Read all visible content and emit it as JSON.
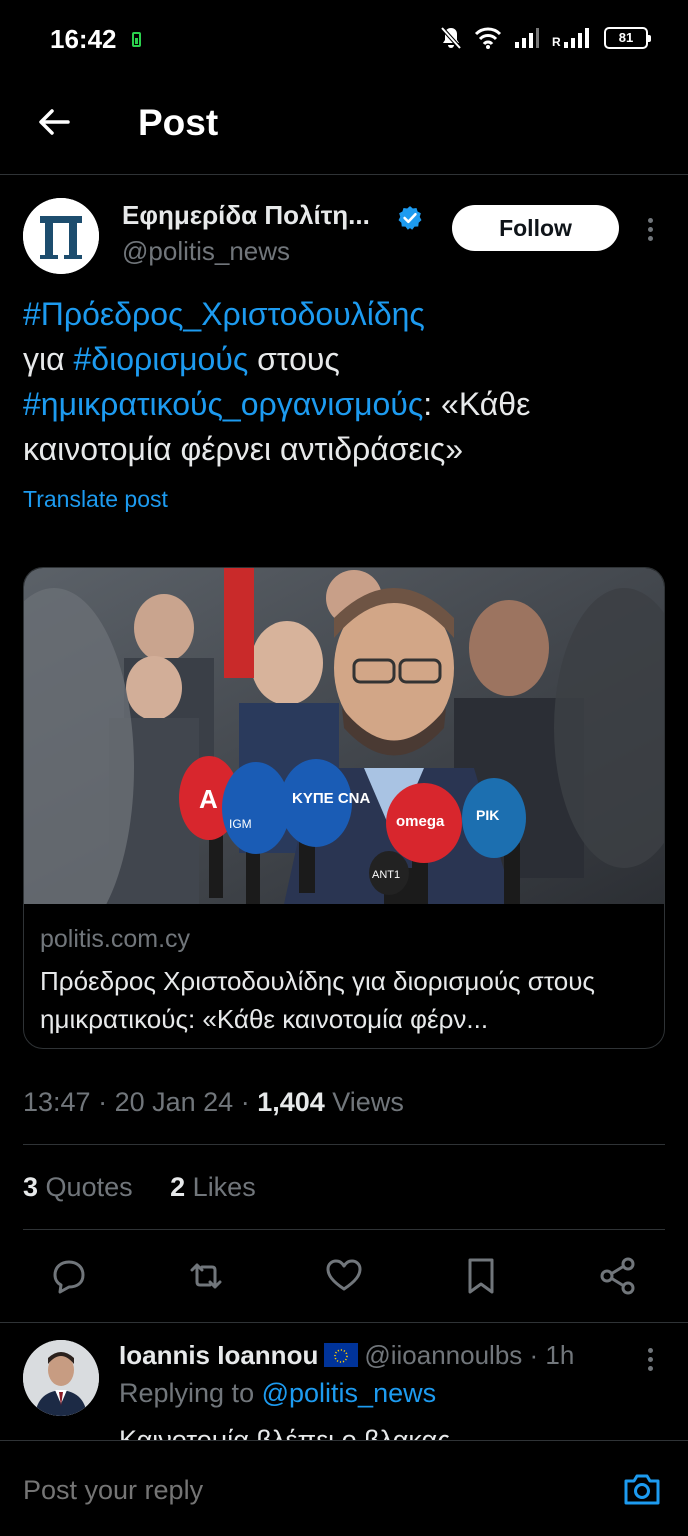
{
  "status_bar": {
    "time": "16:42",
    "battery": "81"
  },
  "header": {
    "title": "Post"
  },
  "tweet": {
    "author_name": "Εφημερίδα Πολίτη...",
    "author_handle": "@politis_news",
    "avatar_letter": "Π",
    "follow_label": "Follow",
    "text_parts": [
      {
        "text": "#Πρόεδρος_Χριστοδουλίδης",
        "hashtag": true
      },
      {
        "text": " για ",
        "hashtag": false
      },
      {
        "text": "#διορισμούς",
        "hashtag": true
      },
      {
        "text": " στους ",
        "hashtag": false
      },
      {
        "text": "#ημικρατικούς_οργανισμούς",
        "hashtag": true
      },
      {
        "text": ": «Κάθε καινοτομία φέρνει αντιδράσεις»",
        "hashtag": false
      }
    ],
    "translate_label": "Translate post",
    "card": {
      "domain": "politis.com.cy",
      "title": "Πρόεδρος Χριστοδουλίδης για διορισμούς στους ημικρατικούς: «Κάθε καινοτομία φέρν...",
      "mic_labels": [
        "Α",
        "IGM",
        "ΚΥΠΕ CNA",
        "omega",
        "ANT1",
        "ΡΙΚ"
      ]
    },
    "time": "13:47",
    "date": "20 Jan 24",
    "views_count": "1,404",
    "views_label": "Views",
    "quotes_count": "3",
    "quotes_label": "Quotes",
    "likes_count": "2",
    "likes_label": "Likes"
  },
  "actions": [
    "reply-icon",
    "repost-icon",
    "like-icon",
    "bookmark-icon",
    "share-icon"
  ],
  "reply": {
    "name": "Ioannis Ioannou",
    "handle": "@iioannoulbs",
    "age": "1h",
    "replying_prefix": "Replying to",
    "replying_to": "@politis_news",
    "text": "Καινοτομία βλέπει ο βλακας"
  },
  "compose": {
    "placeholder": "Post your reply"
  },
  "colors": {
    "accent": "#1d9bf0",
    "background": "#000000",
    "muted": "#71767b",
    "divider": "#2f3336"
  }
}
